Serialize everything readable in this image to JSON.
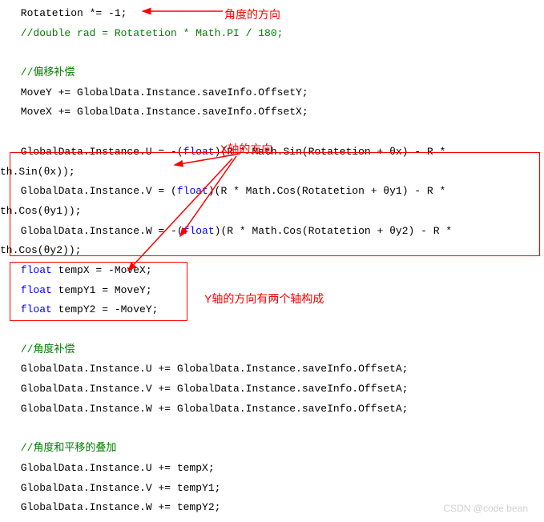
{
  "annotations": {
    "angle_direction": "角度的方向",
    "x_axis_direction": "X轴的方向",
    "y_axis_direction": "Y轴的方向有两个轴构成"
  },
  "code": {
    "l1": " Rotatetion *= -1;",
    "l2_a": " //double rad = Rotatetion * Math.PI / 180;",
    "l3": "",
    "l4": " //偏移补偿",
    "l5": " MoveY += GlobalData.Instance.saveInfo.OffsetY;",
    "l6": " MoveX += GlobalData.Instance.saveInfo.OffsetX;",
    "l7": "",
    "l8_a": " GlobalData.Instance.U = -(",
    "l8_b": "float",
    "l8_c": ")(R * Math.Sin(Rotatetion + θx) - R * ",
    "l9": "th.Sin(θx));",
    "l10_a": " GlobalData.Instance.V = (",
    "l10_b": "float",
    "l10_c": ")(R * Math.Cos(Rotatetion + θy1) - R * ",
    "l11": "th.Cos(θy1));",
    "l12_a": " GlobalData.Instance.W = -(",
    "l12_b": "float",
    "l12_c": ")(R * Math.Cos(Rotatetion + θy2) - R * ",
    "l13": "th.Cos(θy2));",
    "l14_a": " float",
    "l14_b": " tempX = -MoveX;",
    "l15_a": " float",
    "l15_b": " tempY1 = MoveY;",
    "l16_a": " float",
    "l16_b": " tempY2 = -MoveY;",
    "l17": "",
    "l18": " //角度补偿",
    "l19": " GlobalData.Instance.U += GlobalData.Instance.saveInfo.OffsetA;",
    "l20": " GlobalData.Instance.V += GlobalData.Instance.saveInfo.OffsetA;",
    "l21": " GlobalData.Instance.W += GlobalData.Instance.saveInfo.OffsetA;",
    "l22": "",
    "l23": " //角度和平移的叠加",
    "l24": " GlobalData.Instance.U += tempX;",
    "l25": " GlobalData.Instance.V += tempY1;",
    "l26": " GlobalData.Instance.W += tempY2;"
  },
  "watermark": "CSDN @code bean"
}
